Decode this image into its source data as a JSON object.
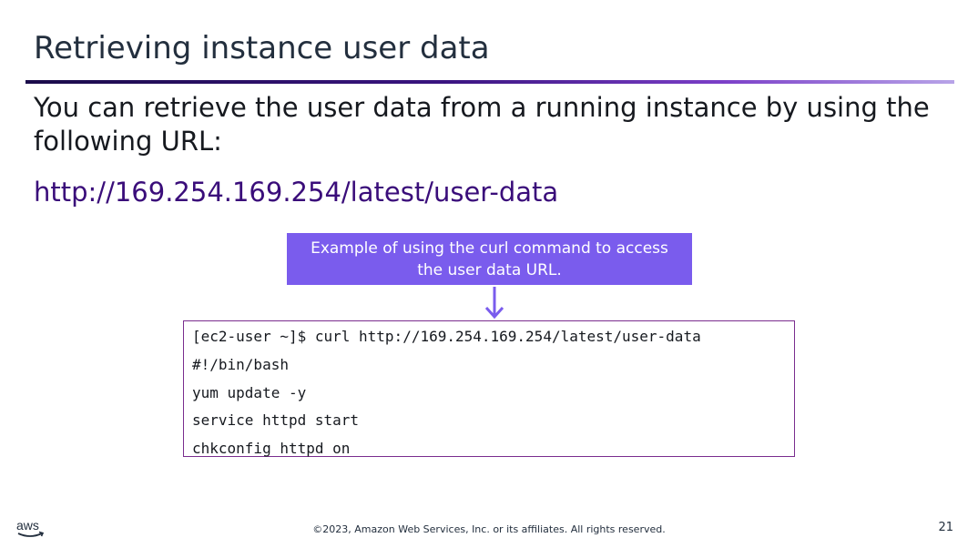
{
  "slide": {
    "title": "Retrieving instance user data",
    "body": "You can retrieve the user data from a running instance by using the following URL:",
    "url": "http://169.254.169.254/latest/user-data"
  },
  "callout": {
    "text": "Example of using the curl command to access the user data URL.",
    "color": "#7a5ced"
  },
  "code": {
    "lines": [
      "[ec2-user ~]$ curl http://169.254.169.254/latest/user-data",
      "#!/bin/bash",
      "yum update -y",
      "service httpd start",
      "chkconfig httpd on"
    ]
  },
  "footer": {
    "logo_text": "aws",
    "copyright": "©2023, Amazon Web Services, Inc. or its affiliates. All rights reserved.",
    "page_number": "21"
  },
  "colors": {
    "accent_purple": "#7a5ced",
    "url_purple": "#3a0d7a",
    "code_border": "#7a2d8e",
    "aws_orange": "#ff9900"
  }
}
